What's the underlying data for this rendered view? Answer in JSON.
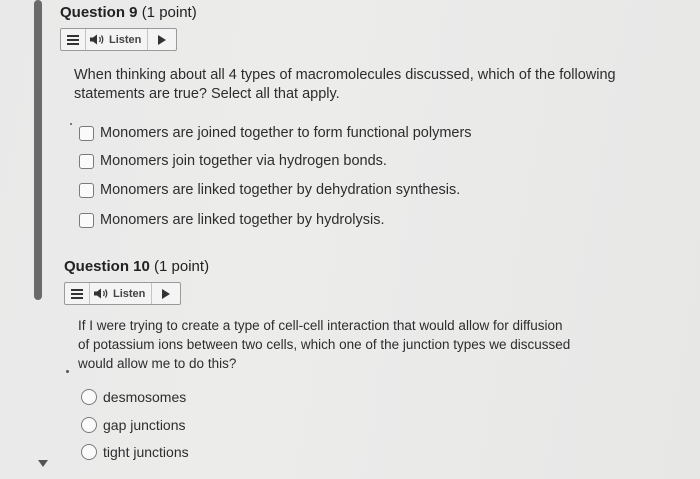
{
  "q9": {
    "title_num": "Question 9",
    "title_pts": "(1 point)",
    "listen_label": "Listen",
    "stem_line1": "When thinking about all 4 types of macromolecules discussed, which of the following",
    "stem_line2": "statements are true? Select all that apply.",
    "options": [
      "Monomers are joined together to form functional polymers",
      "Monomers join together via hydrogen bonds.",
      "Monomers are linked together by dehydration synthesis.",
      "Monomers are linked together by hydrolysis."
    ]
  },
  "q10": {
    "title_num": "Question 10",
    "title_pts": "(1 point)",
    "listen_label": "Listen",
    "stem_line1": "If I were trying to create a type of cell-cell interaction that would allow for diffusion",
    "stem_line2": "of potassium ions between two cells, which one of the junction types we discussed",
    "stem_line3": "would allow me to do this?",
    "options": [
      "desmosomes",
      "gap junctions",
      "tight junctions"
    ]
  }
}
